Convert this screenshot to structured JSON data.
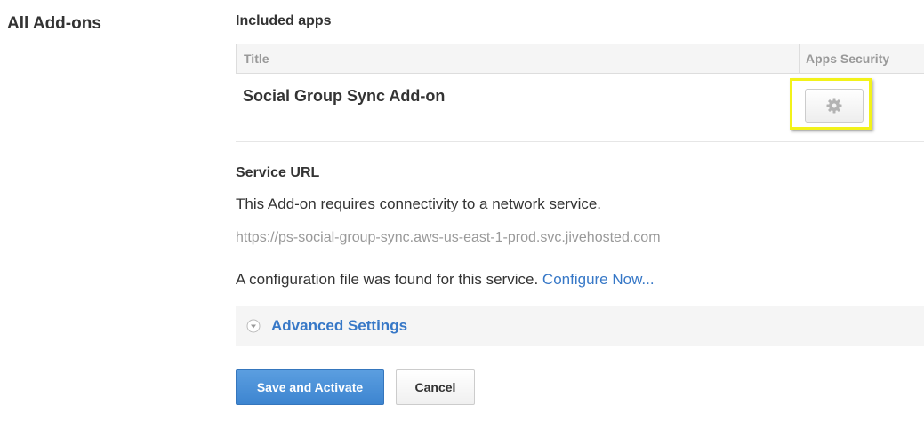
{
  "sidebar": {
    "title": "All Add-ons"
  },
  "included_apps": {
    "heading": "Included apps",
    "columns": {
      "title": "Title",
      "security": "Apps Security"
    },
    "rows": [
      {
        "name": "Social Group Sync Add-on",
        "security_icon": "gear-icon"
      }
    ]
  },
  "service": {
    "heading": "Service URL",
    "description": "This Add-on requires connectivity to a network service.",
    "url": "https://ps-social-group-sync.aws-us-east-1-prod.svc.jivehosted.com",
    "config_text": "A configuration file was found for this service.",
    "config_link": "Configure Now..."
  },
  "advanced": {
    "label": "Advanced Settings",
    "icon": "chevron-down-circle-icon"
  },
  "actions": {
    "save_label": "Save and Activate",
    "cancel_label": "Cancel"
  },
  "colors": {
    "link": "#3778c7",
    "primary_button": "#4a90d9",
    "highlight": "#f2f21a"
  }
}
